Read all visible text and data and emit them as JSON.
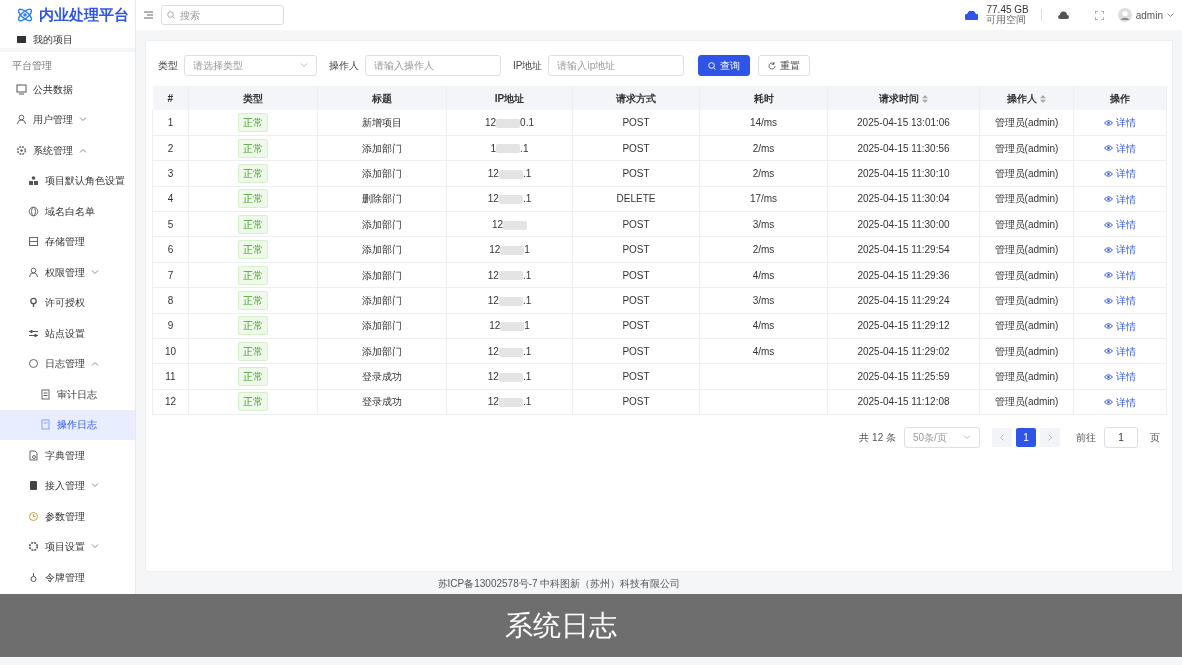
{
  "app": {
    "title": "内业处理平台"
  },
  "header": {
    "search": {
      "placeholder": "搜索"
    },
    "storage": {
      "value": "77.45 GB",
      "label": "可用空间"
    },
    "user": {
      "name": "admin"
    }
  },
  "sidebar": {
    "items": [
      {
        "kind": "link",
        "label": "我的项目",
        "selected": false
      },
      {
        "kind": "section",
        "label": "平台管理"
      },
      {
        "kind": "link",
        "label": "公共数据",
        "selected": false
      },
      {
        "kind": "group",
        "label": "用户管理",
        "expanded": false
      },
      {
        "kind": "group",
        "label": "系统管理",
        "expanded": true,
        "children": [
          {
            "kind": "link",
            "label": "项目默认角色设置",
            "selected": false
          },
          {
            "kind": "link",
            "label": "域名白名单",
            "selected": false
          },
          {
            "kind": "link",
            "label": "存储管理",
            "selected": false
          },
          {
            "kind": "group",
            "label": "权限管理",
            "expanded": false
          },
          {
            "kind": "link",
            "label": "许可授权",
            "selected": false
          },
          {
            "kind": "link",
            "label": "站点设置",
            "selected": false
          },
          {
            "kind": "group",
            "label": "日志管理",
            "expanded": true,
            "children": [
              {
                "kind": "link",
                "label": "审计日志",
                "selected": false
              },
              {
                "kind": "link",
                "label": "操作日志",
                "selected": true
              }
            ]
          },
          {
            "kind": "link",
            "label": "字典管理",
            "selected": false
          },
          {
            "kind": "group",
            "label": "接入管理",
            "expanded": false
          },
          {
            "kind": "link",
            "label": "参数管理",
            "selected": false
          },
          {
            "kind": "group",
            "label": "项目设置",
            "expanded": false
          },
          {
            "kind": "link",
            "label": "令牌管理",
            "selected": false
          }
        ]
      }
    ]
  },
  "filters": [
    {
      "kind": "select",
      "label": "类型",
      "placeholder": "请选择类型"
    },
    {
      "kind": "input",
      "label": "操作人",
      "placeholder": "请输入操作人"
    },
    {
      "kind": "input",
      "label": "IP地址",
      "placeholder": "请输入ip地址"
    }
  ],
  "buttons": [
    {
      "kind": "primary",
      "label": "查询"
    },
    {
      "kind": "default",
      "label": "重置"
    }
  ],
  "table": {
    "columns": [
      {
        "label": "#",
        "sortable": false
      },
      {
        "label": "类型",
        "sortable": false
      },
      {
        "label": "标题",
        "sortable": false
      },
      {
        "label": "IP地址",
        "sortable": false
      },
      {
        "label": "请求方式",
        "sortable": false
      },
      {
        "label": "耗时",
        "sortable": false
      },
      {
        "label": "请求时间",
        "sortable": true
      },
      {
        "label": "操作人",
        "sortable": true
      },
      {
        "label": "操作",
        "sortable": false
      }
    ],
    "rows": [
      {
        "index": "1",
        "type": "正常",
        "title": "新增项目",
        "ip_start": "12",
        "ip_end": "0.1",
        "method": "POST",
        "duration": "14/ms",
        "time": "2025-04-15 13:01:06",
        "operator": "管理员(admin)",
        "action": "详情"
      },
      {
        "index": "2",
        "type": "正常",
        "title": "添加部门",
        "ip_start": "1",
        "ip_end": ".1",
        "method": "POST",
        "duration": "2/ms",
        "time": "2025-04-15 11:30:56",
        "operator": "管理员(admin)",
        "action": "详情"
      },
      {
        "index": "3",
        "type": "正常",
        "title": "添加部门",
        "ip_start": "12",
        "ip_end": ".1",
        "method": "POST",
        "duration": "2/ms",
        "time": "2025-04-15 11:30:10",
        "operator": "管理员(admin)",
        "action": "详情"
      },
      {
        "index": "4",
        "type": "正常",
        "title": "删除部门",
        "ip_start": "12",
        "ip_end": ".1",
        "method": "DELETE",
        "duration": "17/ms",
        "time": "2025-04-15 11:30:04",
        "operator": "管理员(admin)",
        "action": "详情"
      },
      {
        "index": "5",
        "type": "正常",
        "title": "添加部门",
        "ip_start": "12",
        "method": "POST",
        "duration": "3/ms",
        "time": "2025-04-15 11:30:00",
        "operator": "管理员(admin)",
        "action": "详情"
      },
      {
        "index": "6",
        "type": "正常",
        "title": "添加部门",
        "ip_start": "12",
        "ip_end": "1",
        "method": "POST",
        "duration": "2/ms",
        "time": "2025-04-15 11:29:54",
        "operator": "管理员(admin)",
        "action": "详情"
      },
      {
        "index": "7",
        "type": "正常",
        "title": "添加部门",
        "ip_start": "12",
        "ip_end": ".1",
        "method": "POST",
        "duration": "4/ms",
        "time": "2025-04-15 11:29:36",
        "operator": "管理员(admin)",
        "action": "详情"
      },
      {
        "index": "8",
        "type": "正常",
        "title": "添加部门",
        "ip_start": "12",
        "ip_end": ".1",
        "method": "POST",
        "duration": "3/ms",
        "time": "2025-04-15 11:29:24",
        "operator": "管理员(admin)",
        "action": "详情"
      },
      {
        "index": "9",
        "type": "正常",
        "title": "添加部门",
        "ip_start": "12",
        "ip_end": "1",
        "method": "POST",
        "duration": "4/ms",
        "time": "2025-04-15 11:29:12",
        "operator": "管理员(admin)",
        "action": "详情"
      },
      {
        "index": "10",
        "type": "正常",
        "title": "添加部门",
        "ip_start": "12",
        "ip_end": ".1",
        "method": "POST",
        "duration": "4/ms",
        "time": "2025-04-15 11:29:02",
        "operator": "管理员(admin)",
        "action": "详情"
      },
      {
        "index": "11",
        "type": "正常",
        "title": "登录成功",
        "ip_start": "12",
        "ip_end": ".1",
        "method": "POST",
        "time": "2025-04-15 11:25:59",
        "operator": "管理员(admin)",
        "action": "详情"
      },
      {
        "index": "12",
        "type": "正常",
        "title": "登录成功",
        "ip_start": "12",
        "ip_end": ".1",
        "method": "POST",
        "time": "2025-04-15 11:12:08",
        "operator": "管理员(admin)",
        "action": "详情"
      }
    ]
  },
  "pagination": {
    "total": "共 12 条",
    "page_size": "50条/页",
    "pages": [
      {
        "label": "1",
        "selected": true
      }
    ],
    "goto_label": "前往",
    "goto_value": "1",
    "goto_suffix": "页"
  },
  "footer": "苏ICP备13002578号-7 中科图新（苏州）科技有限公司",
  "caption": "系统日志"
}
